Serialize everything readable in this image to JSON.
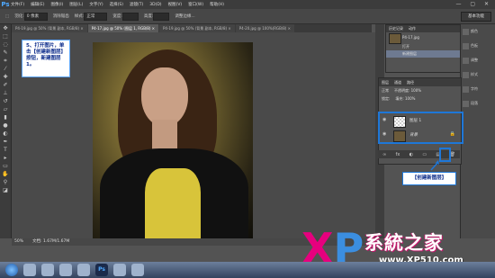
{
  "app": {
    "logo": "Ps"
  },
  "menu": [
    "文件(F)",
    "编辑(E)",
    "图像(I)",
    "图层(L)",
    "文字(Y)",
    "选择(S)",
    "滤镜(T)",
    "3D(D)",
    "视图(V)",
    "窗口(W)",
    "帮助(H)"
  ],
  "window_controls": "— ▢ ✕",
  "options": {
    "feather_label": "羽化:",
    "feather_value": "0 像素",
    "antialias": "消除锯齿",
    "style_label": "样式:",
    "style_value": "正常",
    "width_label": "宽度:",
    "height_label": "高度:",
    "refine_edge": "调整边缘..."
  },
  "workspace": "基本功能",
  "tabs": [
    "P4-19.jpg @ 50% (背景 副本, RGB/8) ×",
    "P4-17.jpg @ 50% (图层 1, RGB/8) ×",
    "P4-19.jpg @ 50% (背景 副本, RGB/8) ×",
    "P4-20.jpg @ 100%(RGB/8) ×"
  ],
  "callout1": "5、打开图片，单击【创建新图层】按钮，新建图层1。",
  "history": {
    "tabs": [
      "历史记录",
      "动作"
    ],
    "doc": "P4-17.jpg",
    "items": [
      "打开",
      "新建图层"
    ]
  },
  "layers": {
    "tabs": [
      "图层",
      "通道",
      "路径"
    ],
    "blend_mode": "正常",
    "opacity_label": "不透明度: 100%",
    "lock_label": "锁定:",
    "fill_label": "填充: 100%",
    "items": [
      {
        "name": "图层 1"
      },
      {
        "name": "背景",
        "lock": "🔒"
      }
    ],
    "footer_icons": [
      "∞",
      "fx",
      "◐",
      "▭",
      "▤",
      "🗑"
    ]
  },
  "callout2": "【创建新图层】",
  "right_column": [
    "颜色",
    "色板",
    "调整",
    "样式",
    "字符",
    "段落"
  ],
  "status": {
    "zoom": "50%",
    "doc": "文档: 1.67M/1.67M"
  },
  "watermark": {
    "x": "X",
    "p": "P",
    "brand": "系統之家",
    "url": "www.XP510.com"
  },
  "taskbar": [
    "",
    "",
    "",
    "",
    "",
    "Ps",
    "",
    ""
  ]
}
